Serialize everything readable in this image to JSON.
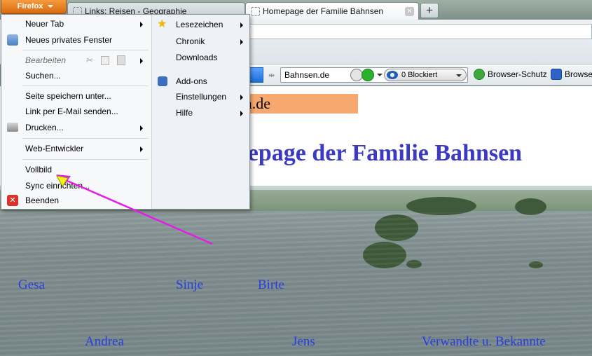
{
  "window": {
    "firefox_button": "Firefox",
    "tabs": [
      {
        "label": "Links: Reisen - Geographie",
        "active": false
      },
      {
        "label": "Homepage der Familie Bahnsen",
        "active": true
      }
    ],
    "new_tab_symbol": "+"
  },
  "toolbar": {
    "search_value": "Bahnsen.de",
    "blocked_label": "0 Blockiert",
    "browser_protection": "Browser-Schutz",
    "browse_truncated": "Browse"
  },
  "menu": {
    "left": [
      {
        "label": "Neuer Tab",
        "submenu": true
      },
      {
        "label": "Neues privates Fenster",
        "icon": "private-window-icon"
      },
      {
        "label": "Bearbeiten",
        "disabled": true
      },
      {
        "label": "Suchen..."
      },
      {
        "label": "Seite speichern unter..."
      },
      {
        "label": "Link per E-Mail senden..."
      },
      {
        "label": "Drucken...",
        "submenu": true,
        "icon": "printer-icon"
      },
      {
        "label": "Web-Entwickler",
        "submenu": true
      },
      {
        "label": "Vollbild"
      },
      {
        "label": "Sync einrichten..."
      },
      {
        "label": "Beenden",
        "icon": "exit-icon"
      }
    ],
    "right": [
      {
        "label": "Lesezeichen",
        "submenu": true,
        "icon": "star-icon"
      },
      {
        "label": "Chronik",
        "submenu": true
      },
      {
        "label": "Downloads"
      },
      {
        "label": "Add-ons",
        "icon": "puzzle-icon"
      },
      {
        "label": "Einstellungen",
        "submenu": true
      },
      {
        "label": "Hilfe",
        "submenu": true
      }
    ]
  },
  "page": {
    "domain_box": "Bahnsen.de",
    "title": "Homepage der Familie Bahnsen",
    "links": [
      "Gesa",
      "Sinje",
      "Birte",
      "Andrea",
      "Jens",
      "Verwandte u. Bekannte"
    ]
  },
  "colors": {
    "firefox_orange": "#e07a1f",
    "page_title": "#3a3ac2",
    "link_blue": "#2a3ee0",
    "domain_box": "#f7a86e",
    "annotation_arrow": "#e21ee6",
    "annotation_cursor": "#f2f21a"
  }
}
